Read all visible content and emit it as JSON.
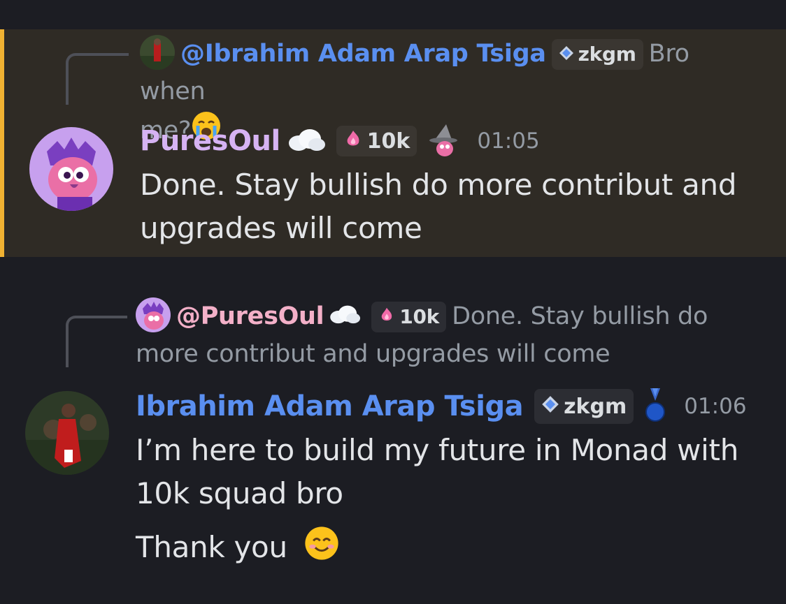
{
  "messages": [
    {
      "highlighted": true,
      "reply": {
        "mention": "@Ibrahim Adam Arap Tsiga",
        "tag": "zkgm",
        "text_before": "Bro when",
        "text_after": "me?"
      },
      "author": "PuresOul",
      "tag": "10k",
      "time": "01:05",
      "lines": [
        "Done. Stay bullish do more contribut and",
        "upgrades will come"
      ]
    },
    {
      "highlighted": false,
      "reply": {
        "mention": "@PuresOul",
        "tag": "10k",
        "text_before": "Done. Stay bullish do",
        "text_after": "more contribut and upgrades will come"
      },
      "author": "Ibrahim Adam Arap Tsiga",
      "tag": "zkgm",
      "time": "01:06",
      "lines": [
        "I’m here to build my future in Monad with",
        "10k squad bro"
      ],
      "extra_line": "Thank you"
    }
  ],
  "colors": {
    "background": "#1c1d23",
    "highlight_bg": "#2f2b25",
    "highlight_border": "#f0b232",
    "mention_blue": "#5a8ff0",
    "author_purple_gradient": [
      "#c6a8f5",
      "#f5b38a"
    ]
  },
  "icons": [
    "cloud-icon",
    "crying-face-emoji",
    "pink-flame-badge-icon",
    "diamond-badge-icon",
    "wizard-hat-icon",
    "medal-icon",
    "smiling-face-emoji"
  ]
}
